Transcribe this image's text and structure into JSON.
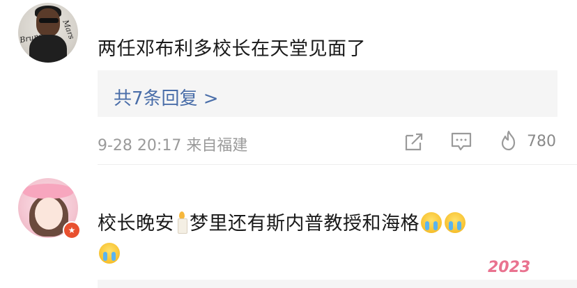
{
  "comment1": {
    "avatar_text_1": "Bruno",
    "avatar_text_2": "Mars",
    "text": "两任邓布利多校长在天堂见面了",
    "reply_link": "共7条回复 >",
    "meta": "9-28 20:17 来自福建",
    "like_count": "780"
  },
  "comment2": {
    "text_part1": "校长晚安",
    "text_part2": "梦里还有斯内普教授和海格",
    "badge_icon": "star-badge-icon"
  },
  "sticker": {
    "text": "2023"
  },
  "colors": {
    "link": "#4a6ea9",
    "meta": "#9a9a9a",
    "reply_bg": "#f5f5f5",
    "badge": "#e8502f"
  }
}
